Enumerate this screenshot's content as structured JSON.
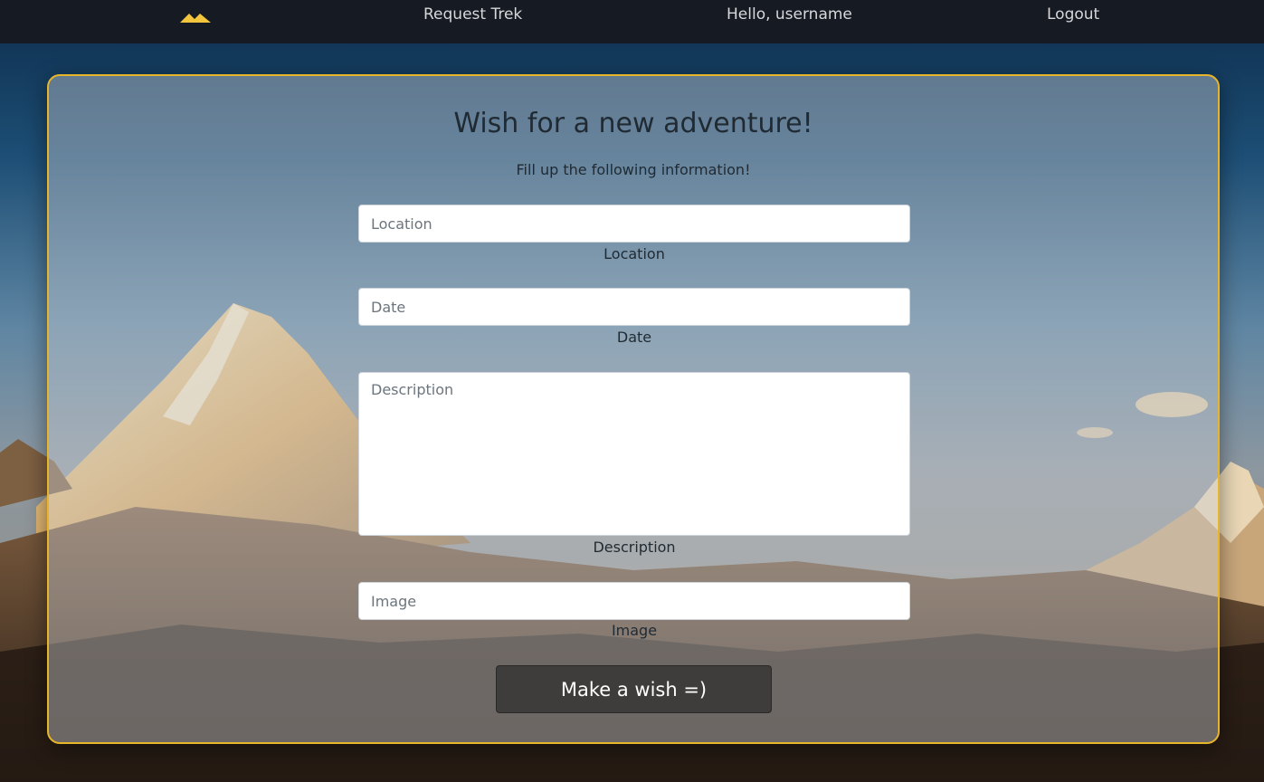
{
  "colors": {
    "navbar_bg": "#161a22",
    "brand_logo": "#f2c53d",
    "card_border": "#e7b52a",
    "button_bg": "#3f3d3c",
    "nav_text": "#d7d8da"
  },
  "navbar": {
    "brand_icon": "mountain-logo-icon",
    "request_trek": "Request Trek",
    "greeting": "Hello, username",
    "logout": "Logout"
  },
  "form": {
    "title": "Wish for a new adventure!",
    "subtitle": "Fill up the following information!",
    "location": {
      "placeholder": "Location",
      "label": "Location",
      "value": ""
    },
    "date": {
      "placeholder": "Date",
      "label": "Date",
      "value": ""
    },
    "description": {
      "placeholder": "Description",
      "label": "Description",
      "value": ""
    },
    "image": {
      "placeholder": "Image",
      "label": "Image",
      "value": ""
    },
    "submit_label": "Make a wish =)"
  }
}
